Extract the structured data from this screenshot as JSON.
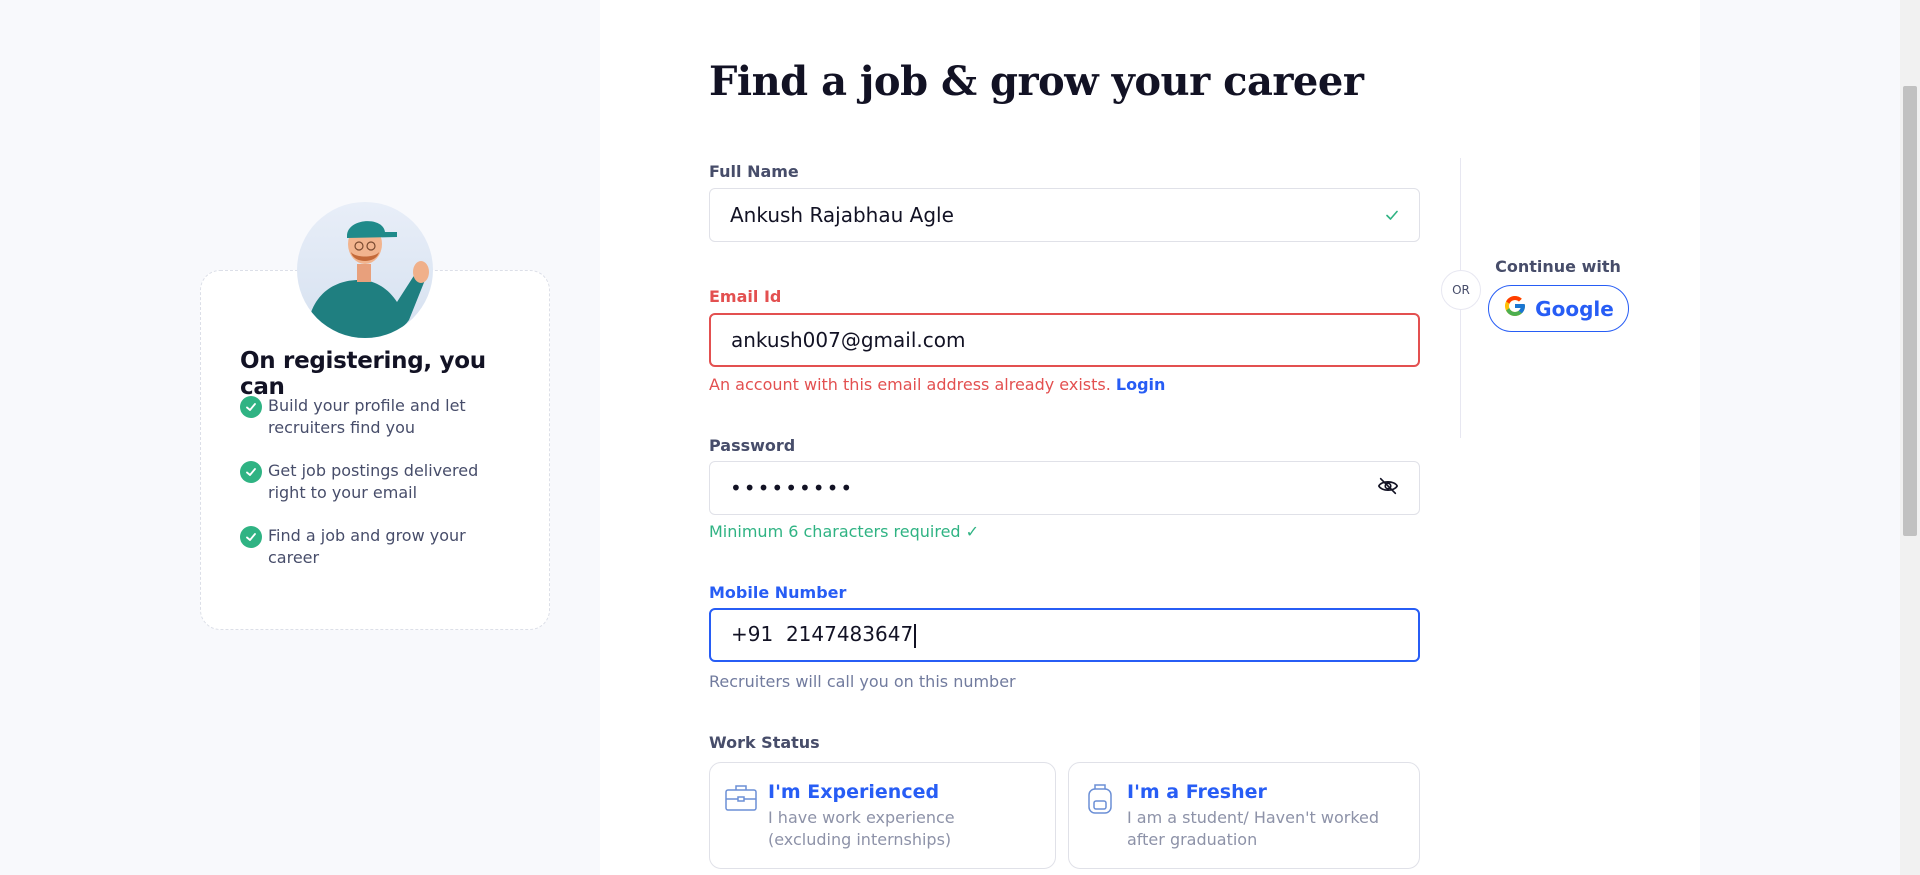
{
  "page": {
    "title": "Find a job & grow your career"
  },
  "form": {
    "full_name": {
      "label": "Full Name",
      "value": "Ankush Rajabhau Agle"
    },
    "email": {
      "label": "Email Id",
      "value": "ankush007@gmail.com",
      "error": "An account with this email address already exists.",
      "error_link": "Login"
    },
    "password": {
      "label": "Password",
      "value": "•••••••••",
      "hint": "Minimum 6 characters required ✓"
    },
    "mobile": {
      "label": "Mobile Number",
      "prefix": "+91",
      "value": "2147483647",
      "hint": "Recruiters will call you on this number"
    },
    "work_status": {
      "label": "Work Status",
      "options": [
        {
          "title": "I'm Experienced",
          "desc": "I have work experience (excluding internships)"
        },
        {
          "title": "I'm a Fresher",
          "desc": "I am a student/ Haven't worked after graduation"
        }
      ]
    }
  },
  "social": {
    "or": "OR",
    "continue_label": "Continue with",
    "google_label": "Google"
  },
  "side": {
    "heading": "On registering, you can",
    "benefits": [
      "Build your profile and let recruiters find you",
      "Get job postings delivered right to your email",
      "Find a job and grow your career"
    ]
  },
  "colors": {
    "accent": "#275df5",
    "error": "#e35050",
    "success": "#2fb383",
    "teal": "#1f8a8a"
  }
}
